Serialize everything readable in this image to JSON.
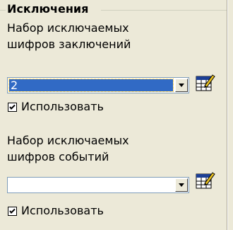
{
  "group": {
    "title": "Исключения"
  },
  "conclusions": {
    "label_line1": "Набор исключаемых",
    "label_line2": "шифров заключений",
    "selected_value": "2",
    "use_label": "Использовать",
    "use_checked": true
  },
  "events": {
    "label_line1": "Набор исключаемых",
    "label_line2": "шифров событий",
    "selected_value": "",
    "use_label": "Использовать",
    "use_checked": true
  },
  "colors": {
    "panel_bg": "#ECE9D8",
    "selection": "#316AC5",
    "combo_border": "#7F9DB9"
  },
  "icons": {
    "editor_button": "table-edit-icon",
    "dropdown": "chevron-down-icon",
    "check": "checkmark-icon"
  }
}
